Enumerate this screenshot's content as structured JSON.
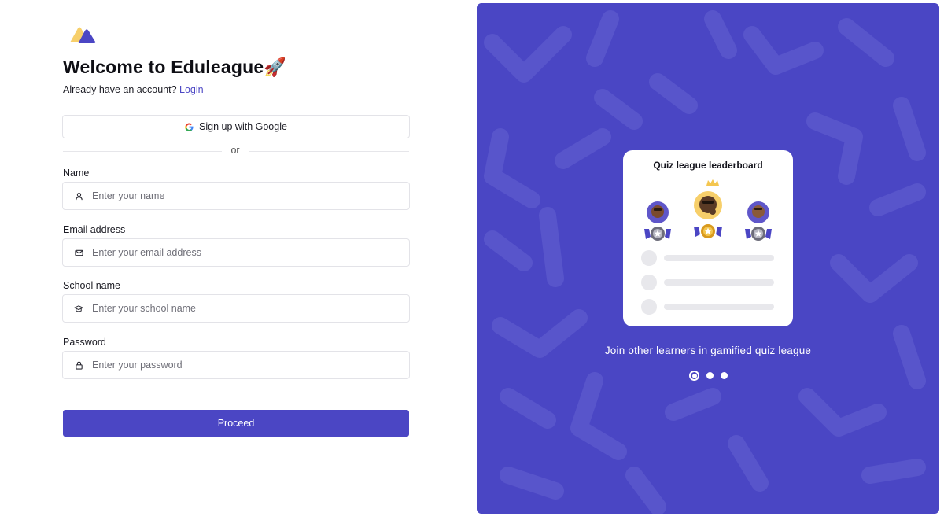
{
  "brand": {
    "logo_icon": "eduleague-logo-icon",
    "primary_color": "#4b46c4",
    "logo_yellow": "#f7cf6a"
  },
  "header": {
    "title": "Welcome to Eduleague🚀",
    "subtitle_text": "Already have an account?",
    "login_link": "Login"
  },
  "google_button": {
    "label": "Sign up with Google",
    "icon": "google-icon"
  },
  "divider_text": "or",
  "form": {
    "name": {
      "label": "Name",
      "placeholder": "Enter your name",
      "icon": "user-icon"
    },
    "email": {
      "label": "Email address",
      "placeholder": "Enter your email address",
      "icon": "mail-icon"
    },
    "school": {
      "label": "School name",
      "placeholder": "Enter your school name",
      "icon": "graduation-cap-icon"
    },
    "password": {
      "label": "Password",
      "placeholder": "Enter your password",
      "icon": "lock-icon"
    }
  },
  "proceed_label": "Proceed",
  "promo": {
    "card_title": "Quiz league leaderboard",
    "caption": "Join other learners in gamified quiz league",
    "slides": 3,
    "active_slide": 1
  }
}
